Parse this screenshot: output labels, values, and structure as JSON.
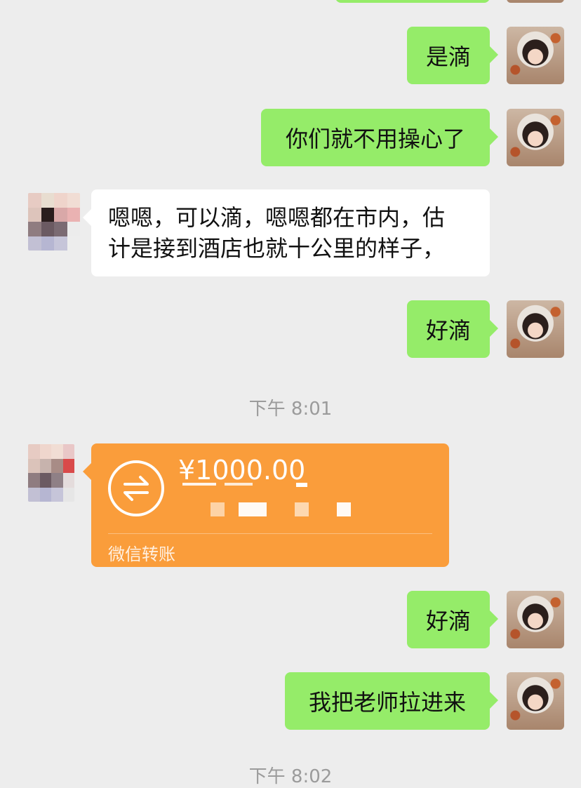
{
  "messages": [
    {
      "side": "me",
      "text": "是滴"
    },
    {
      "side": "me",
      "text": "你们就不用操心了"
    },
    {
      "side": "other",
      "lines": [
        "嗯嗯，可以滴，嗯嗯都在市内，估",
        "计是接到酒店也就十公里的样子，"
      ]
    },
    {
      "side": "me",
      "text": "好滴"
    },
    {
      "side": "me",
      "text": "好滴"
    },
    {
      "side": "me",
      "text": "我把老师拉进来"
    }
  ],
  "timestamps": {
    "first": "下午 8:01",
    "second": "下午 8:02"
  },
  "transfer": {
    "amount": "¥1000.00",
    "label": "微信转账",
    "icon": "transfer-arrows-icon"
  },
  "colors": {
    "background": "#ededed",
    "bubble_me": "#95ec69",
    "bubble_other": "#ffffff",
    "transfer": "#fa9d3b",
    "timestamp": "#9b9b9b"
  }
}
